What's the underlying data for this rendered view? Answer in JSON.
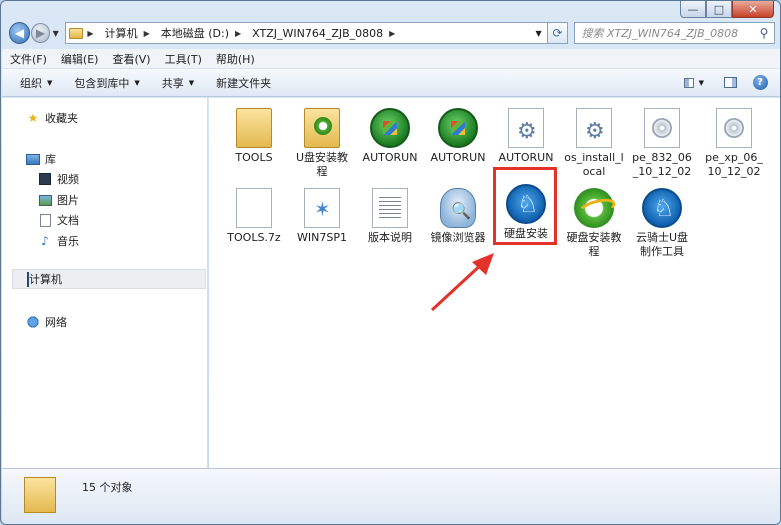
{
  "address": {
    "breadcrumbs": [
      "计算机",
      "本地磁盘 (D:)",
      "XTZJ_WIN764_ZJB_0808"
    ],
    "search_placeholder": "搜索 XTZJ_WIN764_ZJB_0808"
  },
  "menu": [
    "文件(F)",
    "编辑(E)",
    "查看(V)",
    "工具(T)",
    "帮助(H)"
  ],
  "toolbar": {
    "organize": "组织",
    "include_library": "包含到库中",
    "share": "共享",
    "new_folder": "新建文件夹"
  },
  "nav": {
    "favorites": "收藏夹",
    "libraries": "库",
    "videos": "视频",
    "pictures": "图片",
    "documents": "文档",
    "music": "音乐",
    "computer": "计算机",
    "network": "网络"
  },
  "files": [
    {
      "label": "TOOLS",
      "icon": "folder-icon"
    },
    {
      "label": "U盘安装教程",
      "icon": "folder-ie-icon"
    },
    {
      "label": "AUTORUN",
      "icon": "autorun-icon"
    },
    {
      "label": "AUTORUN",
      "icon": "autorun-icon"
    },
    {
      "label": "AUTORUN",
      "icon": "settings-file-icon"
    },
    {
      "label": "os_install_local",
      "icon": "settings-file-icon"
    },
    {
      "label": "pe_832_06_10_12_02",
      "icon": "disc-image-icon"
    },
    {
      "label": "pe_xp_06_10_12_02",
      "icon": "disc-image-icon"
    },
    {
      "label": "TOOLS.7z",
      "icon": "blank-file-icon"
    },
    {
      "label": "WIN7SP1",
      "icon": "image-file-icon"
    },
    {
      "label": "版本说明",
      "icon": "text-file-icon"
    },
    {
      "label": "镜像浏览器",
      "icon": "ghost-icon"
    },
    {
      "label": "硬盘安装",
      "icon": "onekey-icon"
    },
    {
      "label": "硬盘安装教程",
      "icon": "ie-icon"
    },
    {
      "label": "云骑士U盘制作工具",
      "icon": "onekey-icon"
    }
  ],
  "status": {
    "count": "15 个对象"
  },
  "colors": {
    "highlight": "#e23229",
    "window": "#c4d7ec"
  }
}
